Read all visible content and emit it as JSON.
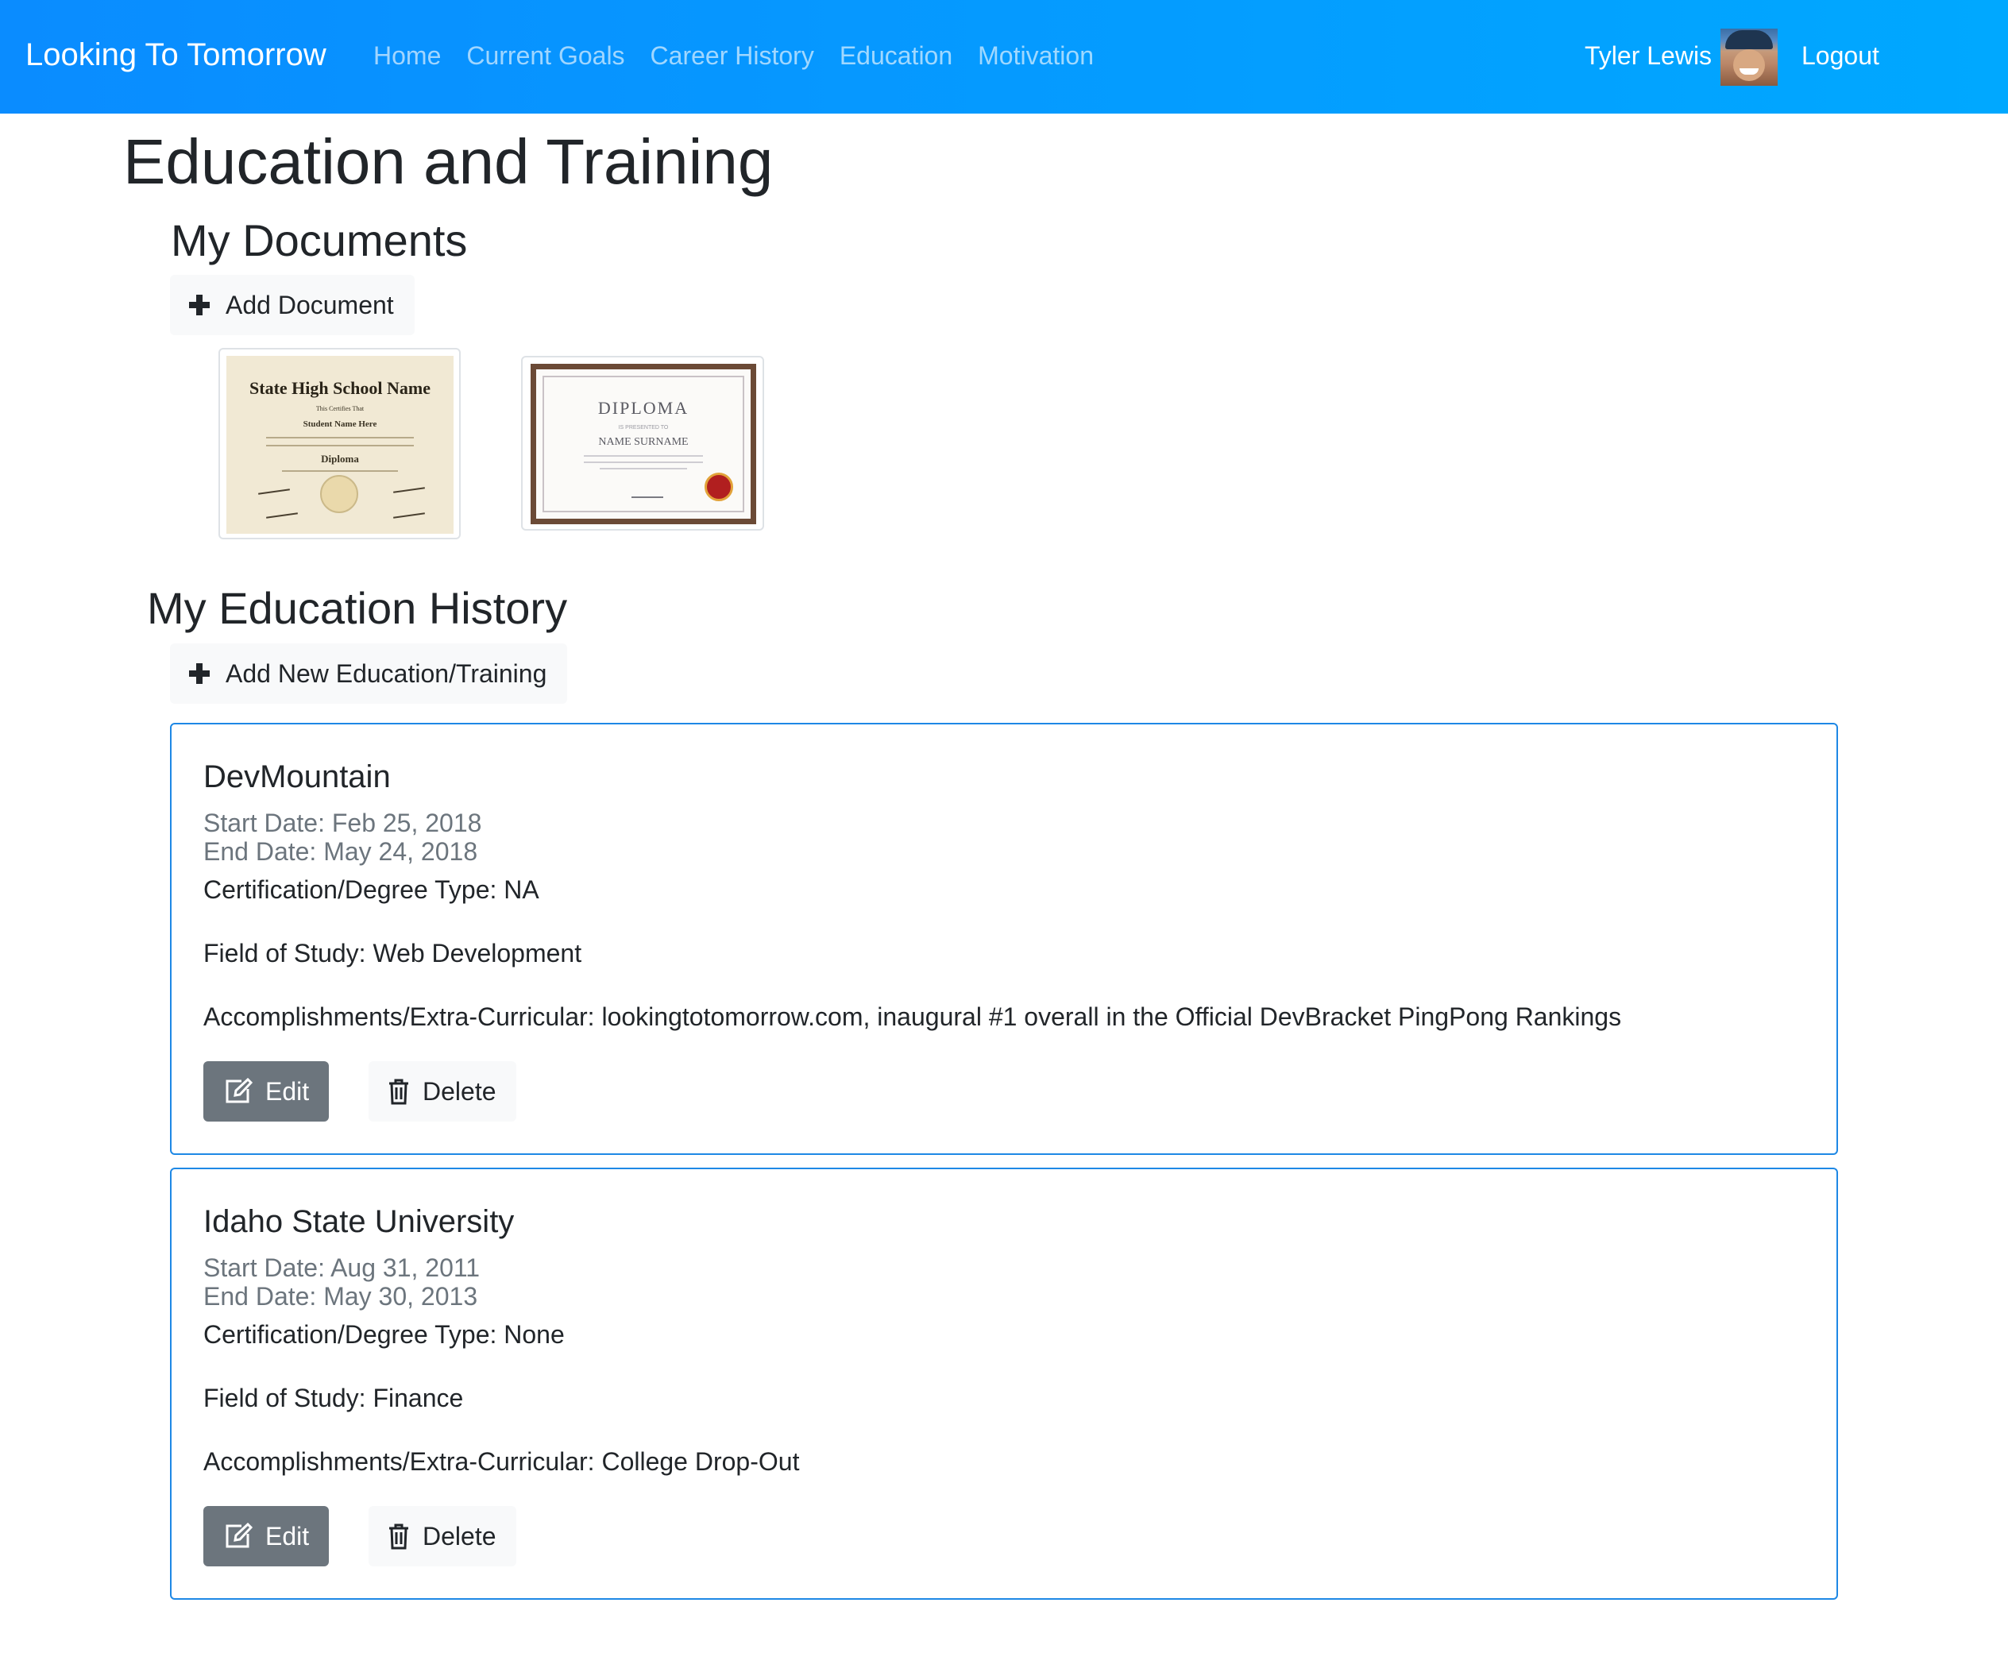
{
  "navbar": {
    "brand": "Looking To Tomorrow",
    "links": [
      "Home",
      "Current Goals",
      "Career History",
      "Education",
      "Motivation"
    ],
    "user_name": "Tyler Lewis",
    "logout_label": "Logout",
    "colors": {
      "gradient_start": "#0a8cff",
      "gradient_end": "#00a8ff"
    }
  },
  "page": {
    "title": "Education and Training"
  },
  "documents": {
    "heading": "My Documents",
    "add_label": "Add Document",
    "add_icon": "plus-icon",
    "items": [
      {
        "school": "State High School Name",
        "certifies": "This Certifies That",
        "student": "Student Name Here",
        "award": "Diploma"
      },
      {
        "title": "DIPLOMA",
        "presented": "IS PRESENTED TO",
        "name": "NAME SURNAME"
      }
    ]
  },
  "education": {
    "heading": "My Education History",
    "add_label": "Add New Education/Training",
    "add_icon": "plus-icon",
    "edit_label": "Edit",
    "delete_label": "Delete",
    "entries": [
      {
        "school": "DevMountain",
        "start": "Start Date: Feb 25, 2018",
        "end": "End Date: May 24, 2018",
        "degree": "Certification/Degree Type: NA",
        "field": "Field of Study: Web Development",
        "accomplishments": "Accomplishments/Extra-Curricular: lookingtotomorrow.com, inaugural #1 overall in the Official DevBracket PingPong Rankings"
      },
      {
        "school": "Idaho State University",
        "start": "Start Date: Aug 31, 2011",
        "end": "End Date: May 30, 2013",
        "degree": "Certification/Degree Type: None",
        "field": "Field of Study: Finance",
        "accomplishments": "Accomplishments/Extra-Curricular: College Drop-Out"
      }
    ]
  },
  "colors": {
    "card_border": "#1e88e5",
    "edit_button": "#6c757d",
    "muted_text": "#6c757d",
    "light_button": "#f8f9fa"
  }
}
